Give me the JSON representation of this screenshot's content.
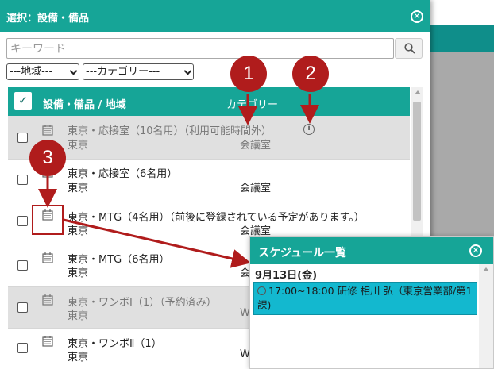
{
  "dialog": {
    "title": "選択：設備・備品",
    "close_icon": "close-circle-icon"
  },
  "search": {
    "placeholder": "キーワード",
    "value": "",
    "button_icon": "search-icon"
  },
  "filters": {
    "region_select": "---地域---",
    "category_select": "---カテゴリー---"
  },
  "table": {
    "headers": {
      "check_all": "✓",
      "name": "設備・備品 / 地域",
      "category": "カテゴリー"
    },
    "rows": [
      {
        "name": "東京・応接室（10名用）（利用可能時間外）",
        "area": "東京",
        "category": "会議室",
        "disabled": true,
        "info_icon": "info-icon"
      },
      {
        "name": "東京・応接室（6名用）",
        "area": "東京",
        "category": "会議室",
        "disabled": false
      },
      {
        "name": "東京・MTG（4名用）（前後に登録されている予定があります。）",
        "area": "東京",
        "category": "会議室",
        "disabled": false
      },
      {
        "name": "東京・MTG（6名用）",
        "area": "東京",
        "category": "会",
        "disabled": false
      },
      {
        "name": "東京・ワンボⅠ（1）（予約済み）",
        "area": "東京",
        "category": "W",
        "disabled": true
      },
      {
        "name": "東京・ワンボⅡ（1）",
        "area": "東京",
        "category": "W",
        "disabled": false
      }
    ]
  },
  "markers": [
    "1",
    "2",
    "3"
  ],
  "popup": {
    "title": "スケジュール一覧",
    "close_icon": "close-circle-icon",
    "date": "9月13日(金)",
    "event_line1": "17:00~18:00 研修 相川 弘（東京営業部/第1",
    "event_line2": "課)",
    "event_icon": "clock-icon"
  },
  "colors": {
    "header_teal": "#16a597",
    "marker_red": "#b01c1c",
    "event_cyan": "#13b8cf",
    "disabled_row": "#e0e0e0"
  }
}
